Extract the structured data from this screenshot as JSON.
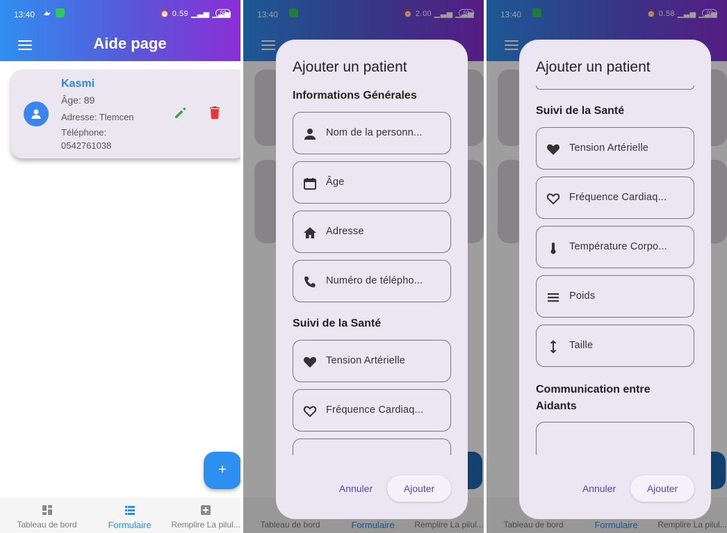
{
  "status": {
    "time": "13:40",
    "net1": "0.59",
    "net2": "2.00",
    "net3": "0.58",
    "battery": "60"
  },
  "appbar": {
    "title": "Aide page"
  },
  "patient": {
    "name": "Kasmi",
    "age": "Âge: 89",
    "address": "Adresse: Tlemcen",
    "phone_label": "Téléphone:",
    "phone": "0542761038"
  },
  "fab": {
    "label": "+"
  },
  "nav": {
    "items": [
      {
        "label": "Tableau de bord"
      },
      {
        "label": "Formulaire"
      },
      {
        "label": "Remplire La pilul..."
      }
    ]
  },
  "dialog": {
    "title": "Ajouter un patient",
    "general_title": "Informations Générales",
    "health_title": "Suivi de la Santé",
    "comm_title": "Communication entre Aidants",
    "fields": {
      "name": "Nom de la personn...",
      "age": "Âge",
      "address": "Adresse",
      "phone": "Numéro de télépho...",
      "bp": "Tension Artérielle",
      "hr": "Fréquence Cardiaq...",
      "temp": "Température Corpo...",
      "weight": "Poids",
      "height": "Taille"
    },
    "cancel": "Annuler",
    "add": "Ajouter"
  },
  "colors": {
    "accent": "#2e86de",
    "delete": "#e53935",
    "edit": "#43a047"
  }
}
